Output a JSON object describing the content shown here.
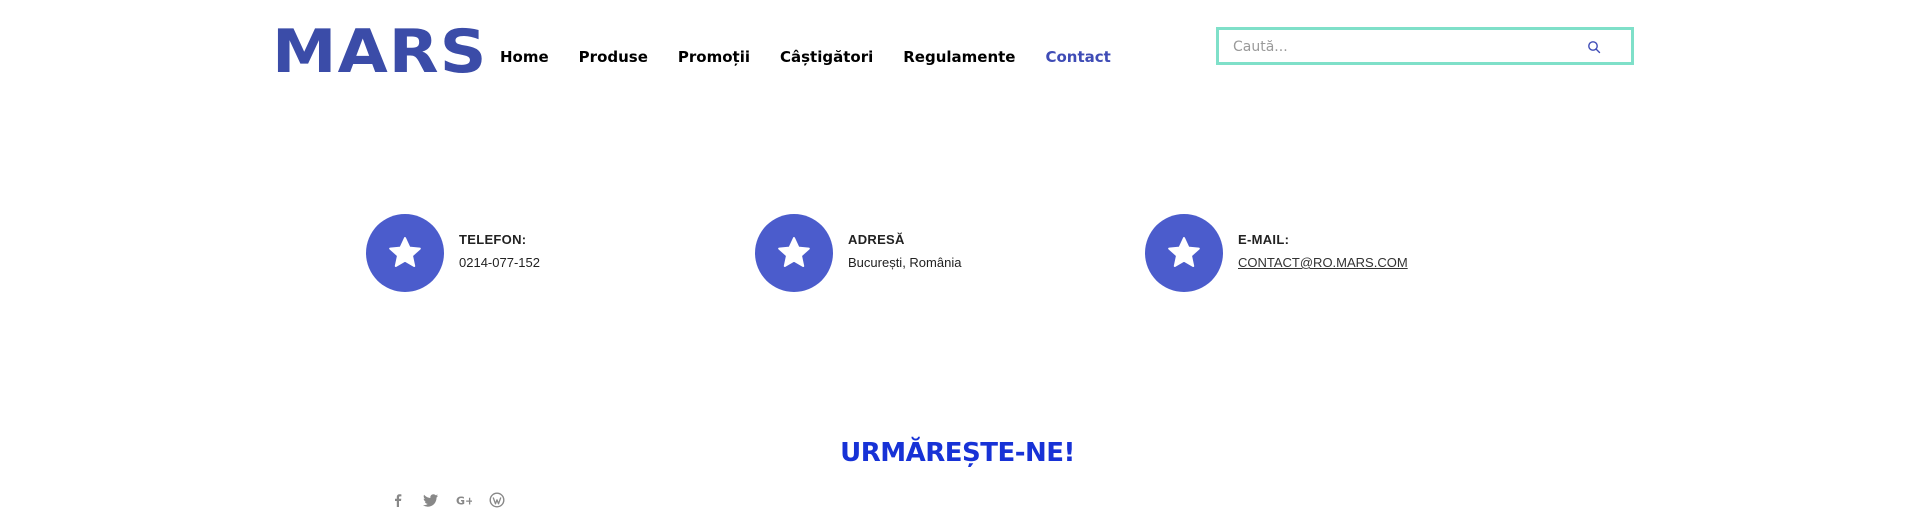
{
  "colors": {
    "brand": "#3b4ca8",
    "accent": "#4b5ccc",
    "nav_active": "#3f4cb6",
    "search_border": "#7fe0c9",
    "follow_heading": "#1732d6",
    "social_icon": "#888888"
  },
  "header": {
    "logo": "MARS",
    "nav": [
      {
        "label": "Home"
      },
      {
        "label": "Produse"
      },
      {
        "label": "Promoții"
      },
      {
        "label": "Câștigători"
      },
      {
        "label": "Regulamente"
      },
      {
        "label": "Contact",
        "active": true
      }
    ],
    "search": {
      "placeholder": "Caută..."
    }
  },
  "contacts": [
    {
      "icon": "star-icon",
      "label": "TELEFON:",
      "value": "0214-077-152"
    },
    {
      "icon": "star-icon",
      "label": "ADRESĂ",
      "value": "București, România"
    },
    {
      "icon": "star-icon",
      "label": "E-MAIL:",
      "value": "CONTACT@RO.MARS.COM"
    }
  ],
  "follow": {
    "heading": "URMĂREȘTE-NE!",
    "social": [
      "facebook-icon",
      "twitter-icon",
      "google-plus-icon",
      "wordpress-icon"
    ]
  }
}
